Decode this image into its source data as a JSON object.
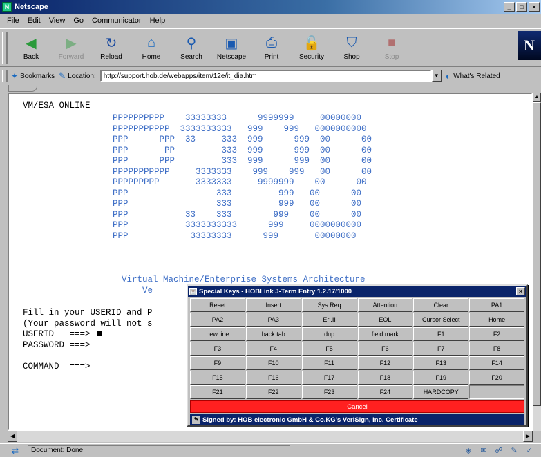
{
  "window": {
    "title": "Netscape",
    "controls": {
      "minimize": "_",
      "maximize": "□",
      "close": "×"
    }
  },
  "menu": [
    "File",
    "Edit",
    "View",
    "Go",
    "Communicator",
    "Help"
  ],
  "toolbar": {
    "buttons": [
      {
        "label": "Back",
        "icon": "back-arrow-icon",
        "glyph": "◀",
        "enabled": true,
        "color": "#2a9a3a"
      },
      {
        "label": "Forward",
        "icon": "forward-arrow-icon",
        "glyph": "▶",
        "enabled": false,
        "color": "#2a9a3a"
      },
      {
        "label": "Reload",
        "icon": "reload-icon",
        "glyph": "↻",
        "enabled": true,
        "color": "#1a4aa0"
      },
      {
        "label": "Home",
        "icon": "home-icon",
        "glyph": "⌂",
        "enabled": true,
        "color": "#1a6ac0"
      },
      {
        "label": "Search",
        "icon": "search-icon",
        "glyph": "⚲",
        "enabled": true,
        "color": "#1a5ab0"
      },
      {
        "label": "Netscape",
        "icon": "netscape-icon",
        "glyph": "▣",
        "enabled": true,
        "color": "#1a5ab0"
      },
      {
        "label": "Print",
        "icon": "print-icon",
        "glyph": "⎙",
        "enabled": true,
        "color": "#1a5ab0"
      },
      {
        "label": "Security",
        "icon": "lock-icon",
        "glyph": "🔓",
        "enabled": true,
        "color": "#b08000"
      },
      {
        "label": "Shop",
        "icon": "shop-icon",
        "glyph": "⛉",
        "enabled": true,
        "color": "#1a5ab0"
      },
      {
        "label": "Stop",
        "icon": "stop-icon",
        "glyph": "■",
        "enabled": false,
        "color": "#a01010"
      }
    ],
    "logo": "N"
  },
  "location": {
    "bookmarks_label": "Bookmarks",
    "location_label": "Location:",
    "url": "http://support.hob.de/webapps/item/12e/it_dia.htm",
    "related_label": "What's Related"
  },
  "terminal": {
    "banner": "VM/ESA ONLINE",
    "logo_lines": [
      "PPPPPPPPPP    33333333      9999999     00000000",
      "PPPPPPPPPPP  3333333333   999    999   0000000000",
      "PPP      PPP  33     333  999      999  00      00",
      "PPP       PP         333  999      999  00      00",
      "PPP      PPP         333  999      999  00      00",
      "PPPPPPPPPPP     3333333    999    999   00      00",
      "PPPPPPPPP       3333333     9999999    00      00",
      "PPP                 333         999   00      00",
      "PPP                 333         999   00      00",
      "PPP           33    333        999    00      00",
      "PPP           3333333333      999     0000000000",
      "PPP            33333333      999       00000000"
    ],
    "caption_lines": [
      "Virtual Machine/Enterprise Systems Architecture",
      "    Ve"
    ],
    "prompt_lines": [
      "Fill in your USERID and P",
      "(Your password will not s",
      "USERID   ===>",
      "PASSWORD ===>",
      "",
      "COMMAND  ===>"
    ]
  },
  "special_keys": {
    "title": "Special Keys - HOBLink J-Term Entry 1.2.17/1000",
    "keys": [
      "Reset",
      "Insert",
      "Sys Req",
      "Attention",
      "Clear",
      "PA1",
      "PA2",
      "PA3",
      "Erl.II",
      "EOL",
      "Cursor Select",
      "Home",
      "new line",
      "back tab",
      "dup",
      "field mark",
      "F1",
      "F2",
      "F3",
      "F4",
      "F5",
      "F6",
      "F7",
      "F8",
      "F9",
      "F10",
      "F11",
      "F12",
      "F13",
      "F14",
      "F15",
      "F16",
      "F17",
      "F18",
      "F19",
      "F20",
      "F21",
      "F22",
      "F23",
      "F24",
      "HARDCOPY",
      ""
    ],
    "cancel_label": "Cancel",
    "signed_label": "Signed by: HOB electronic GmbH & Co.KG's VeriSign, Inc. Certificate"
  },
  "status": {
    "text": "Document: Done"
  },
  "colors": {
    "terminal_blue": "#3f6fc6",
    "title_blue": "#0a246a",
    "cancel_red": "#ff2020"
  }
}
